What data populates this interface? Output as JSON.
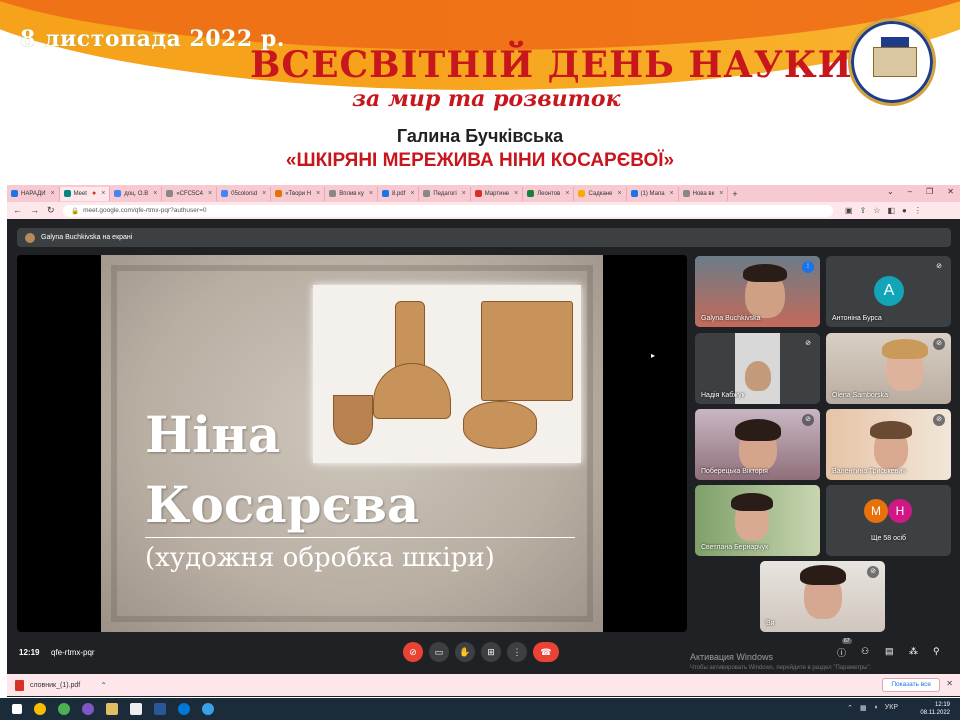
{
  "banner": {
    "date": "8 листопада 2022 р.",
    "title": "ВСЕСВІТНІЙ ДЕНЬ НАУКИ",
    "subtitle": "за мир та розвиток",
    "speaker": "Галина Бучківська",
    "talk_title": "«ШКІРЯНІ МЕРЕЖИВА НІНИ КОСАРЄВОЇ»"
  },
  "browser": {
    "tabs": [
      {
        "label": "НАРАДИ",
        "color": "#1a73e8"
      },
      {
        "label": "Meet",
        "color": "#00897b",
        "active": true
      },
      {
        "label": "доц. О.В",
        "color": "#4285f4"
      },
      {
        "label": "«СFС5С4",
        "color": "#5f6368"
      },
      {
        "label": "05colorsd",
        "color": "#4285f4"
      },
      {
        "label": "«Твори Н",
        "color": "#e37400"
      },
      {
        "label": "Вплив ку",
        "color": "#5f6368"
      },
      {
        "label": "8.pdf",
        "color": "#1a73e8"
      },
      {
        "label": "Педагогі",
        "color": "#5f6368"
      },
      {
        "label": "Мартине",
        "color": "#d93025"
      },
      {
        "label": "Леонтов",
        "color": "#188038"
      },
      {
        "label": "Садкане",
        "color": "#f9ab00"
      },
      {
        "label": "(1) Мапа",
        "color": "#1a73e8"
      },
      {
        "label": "Нова вк",
        "color": "#5f6368"
      }
    ],
    "url": "meet.google.com/qfe-rtmx-pqr?authuser=0"
  },
  "meet": {
    "presenting_label": "Galyna Buchkivska на екрані",
    "slide": {
      "name_line1": "Ніна",
      "name_line2": "Косарєва",
      "subtitle": "(художня обробка шкіри)"
    },
    "participants": [
      {
        "name": "Galyna Buchkivska"
      },
      {
        "name": "Антоніна Бурса",
        "initial": "A"
      },
      {
        "name": "Надія Кабжук"
      },
      {
        "name": "Olena Samborska"
      },
      {
        "name": "Поберецька Вікторія"
      },
      {
        "name": "Валентина Гриськевич"
      },
      {
        "name": "Светлана Бернарчук"
      },
      {
        "name": "Ще 58 осіб",
        "initials": [
          "M",
          "H"
        ]
      },
      {
        "name": "Ви"
      }
    ],
    "time": "12:19",
    "meeting_code": "qfe-rtmx-pqr",
    "people_count": "67",
    "activation_title": "Активация Windows",
    "activation_sub": "Чтобы активировать Windows, перейдите в раздел \"Параметры\"."
  },
  "downloads": {
    "file": "словник_(1).pdf",
    "show_all": "Показать все"
  },
  "taskbar": {
    "lang": "УКР",
    "time": "12:19",
    "date": "08.11.2022"
  }
}
